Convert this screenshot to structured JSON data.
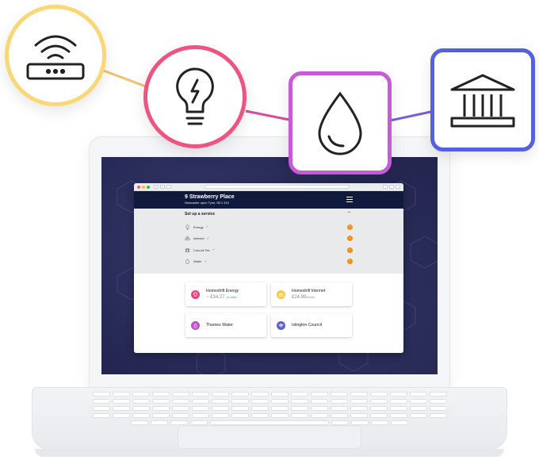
{
  "browser": {
    "header": {
      "address_line1": "9 Strawberry Place",
      "address_line2": "Newcastle upon Tyne, NE1 4SJ"
    },
    "setup": {
      "title": "Set up a service",
      "services": [
        {
          "label": "Energy",
          "icon": "lightbulb-icon",
          "check": "✓"
        },
        {
          "label": "Internet",
          "icon": "router-icon",
          "check": "✓"
        },
        {
          "label": "Council Tax",
          "icon": "bank-icon",
          "check": "✓"
        },
        {
          "label": "Water",
          "icon": "water-drop-icon",
          "check": "✓"
        }
      ]
    },
    "cards": [
      {
        "name": "Homeshift Energy",
        "price": "~ £34.27",
        "price_extra": "(to date)",
        "color": "#e8457a"
      },
      {
        "name": "Homeshift Internet",
        "price": "£24.99",
        "price_unit": "/month",
        "color": "#f6c94c"
      },
      {
        "name": "Thames Water",
        "color": "#c04fc8"
      },
      {
        "name": "Islington Council",
        "color": "#5a5fd8"
      }
    ]
  },
  "floating_icons": [
    {
      "name": "router-icon",
      "border_color": "#f7d873"
    },
    {
      "name": "lightbulb-icon",
      "border_color": "#f0537f"
    },
    {
      "name": "water-drop-icon",
      "border_color": "#c75ad6"
    },
    {
      "name": "bank-icon",
      "border_color": "#5560e0"
    }
  ],
  "colors": {
    "header_bg": "#0f1a3c",
    "accent_orange": "#f28c1a",
    "check_green": "#2eb872",
    "screen_bg": "#23254f"
  }
}
